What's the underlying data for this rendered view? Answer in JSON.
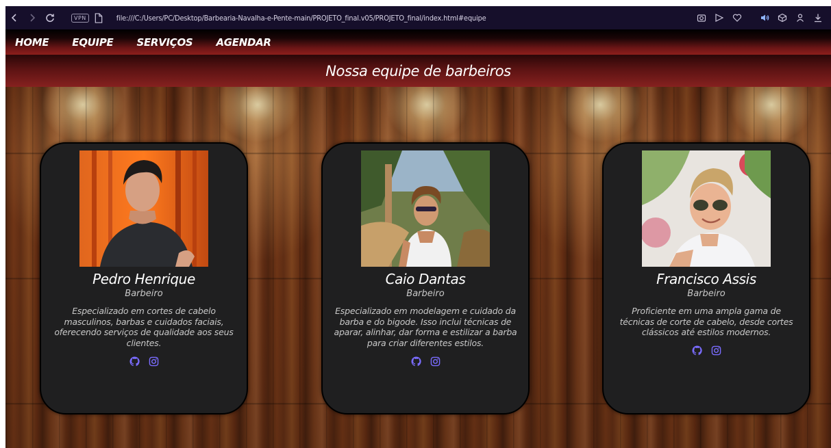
{
  "browser": {
    "vpn_label": "VPN",
    "url": "file:///C:/Users/PC/Desktop/Barbearia-Navalha-e-Pente-main/PROJETO_final.v05/PROJETO_final/index.html#equipe",
    "icons": [
      "back-icon",
      "forward-icon",
      "reload-icon",
      "page-icon",
      "camera-icon",
      "send-icon",
      "heart-icon",
      "speaker-icon",
      "cube-icon",
      "profile-icon",
      "download-icon"
    ]
  },
  "nav": {
    "items": [
      {
        "label": "HOME"
      },
      {
        "label": "EQUIPE"
      },
      {
        "label": "SERVIÇOS"
      },
      {
        "label": "AGENDAR"
      }
    ]
  },
  "section": {
    "title": "Nossa equipe de barbeiros"
  },
  "team": [
    {
      "name": "Pedro Henrique",
      "role": "Barbeiro",
      "description": "Especializado em cortes de cabelo masculinos, barbas e cuidados faciais, oferecendo serviços de qualidade aos seus clientes.",
      "social": [
        "github-icon",
        "instagram-icon"
      ]
    },
    {
      "name": "Caio Dantas",
      "role": "Barbeiro",
      "description": "Especializado em modelagem e cuidado da barba e do bigode. Isso inclui técnicas de aparar, alinhar, dar forma e estilizar a barba para criar diferentes estilos.",
      "social": [
        "github-icon",
        "instagram-icon"
      ]
    },
    {
      "name": "Francisco Assis",
      "role": "Barbeiro",
      "description": "Proficiente em uma ampla gama de técnicas de corte de cabelo, desde cortes clássicos até estilos modernos.",
      "social": [
        "github-icon",
        "instagram-icon"
      ]
    }
  ],
  "colors": {
    "nav_red": "#8d1e1c",
    "card_bg": "#1f1f20",
    "social_icon": "#7a6cff",
    "browser_bar": "#160f2b"
  }
}
